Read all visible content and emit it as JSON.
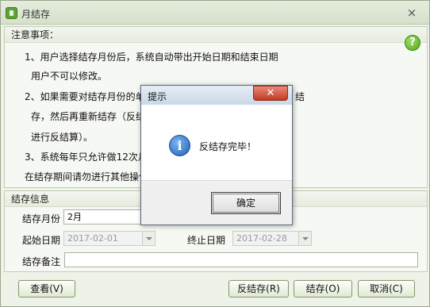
{
  "window": {
    "title": "月结存",
    "close_glyph": "×"
  },
  "notice": {
    "heading": "注意事项：",
    "lines": [
      "1、用户选择结存月份后，系统自动带出开始日期和结束日期",
      "用户不可以修改。",
      "2、如果需要对结存月份的单",
      "存，然后再重新结存（反结",
      "进行反结算）。",
      "3、系统每年只允许做12次月",
      "在结存期间请勿进行其他操作"
    ],
    "line_2_tail": "结"
  },
  "info": {
    "heading": "结存信息",
    "month_label": "结存月份",
    "month_value": "2月",
    "start_label": "起始日期",
    "start_value": "2017-02-01",
    "end_label": "终止日期",
    "end_value": "2017-02-28",
    "remark_label": "结存备注",
    "remark_value": ""
  },
  "buttons": {
    "view": "查看(V)",
    "unsettle": "反结存(R)",
    "settle": "结存(O)",
    "cancel": "取消(C)"
  },
  "dialog": {
    "title": "提示",
    "message": "反结存完毕！",
    "ok": "确定",
    "close_glyph": "✕"
  },
  "icons": {
    "help": "?",
    "info": "i"
  },
  "colors": {
    "window_bg": "#eef2e8",
    "accent_green": "#55a622",
    "dialog_close": "#c23b22",
    "info_blue": "#1f5fb5"
  }
}
